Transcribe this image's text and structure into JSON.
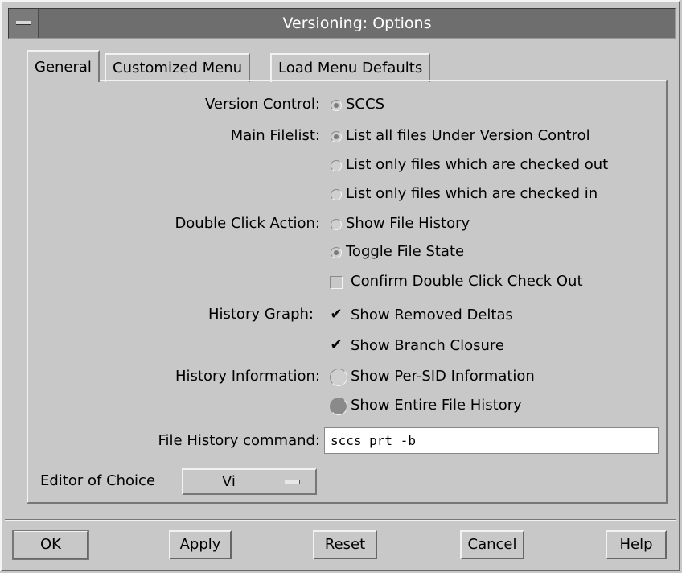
{
  "window": {
    "title": "Versioning: Options"
  },
  "tabs": [
    "General",
    "Customized Menu",
    "Load Menu Defaults"
  ],
  "form": {
    "version_control": {
      "label": "Version Control:",
      "value": "SCCS"
    },
    "main_filelist": {
      "label": "Main Filelist:",
      "options": [
        "List all files Under Version Control",
        "List only files which are checked out",
        "List only files which are checked in"
      ]
    },
    "double_click": {
      "label": "Double Click Action:",
      "options": [
        "Show File History",
        "Toggle File State"
      ],
      "confirm": "Confirm Double Click Check Out"
    },
    "history_graph": {
      "label": "History Graph:",
      "options": [
        "Show Removed Deltas",
        "Show Branch Closure"
      ]
    },
    "history_info": {
      "label": "History Information:",
      "options": [
        "Show Per-SID Information",
        "Show Entire File History"
      ]
    },
    "file_history_cmd": {
      "label": "File History command:",
      "value": "sccs prt -b"
    },
    "editor": {
      "label": "Editor of Choice",
      "value": "Vi"
    }
  },
  "buttons": {
    "ok": "OK",
    "apply": "Apply",
    "reset": "Reset",
    "cancel": "Cancel",
    "help": "Help"
  }
}
